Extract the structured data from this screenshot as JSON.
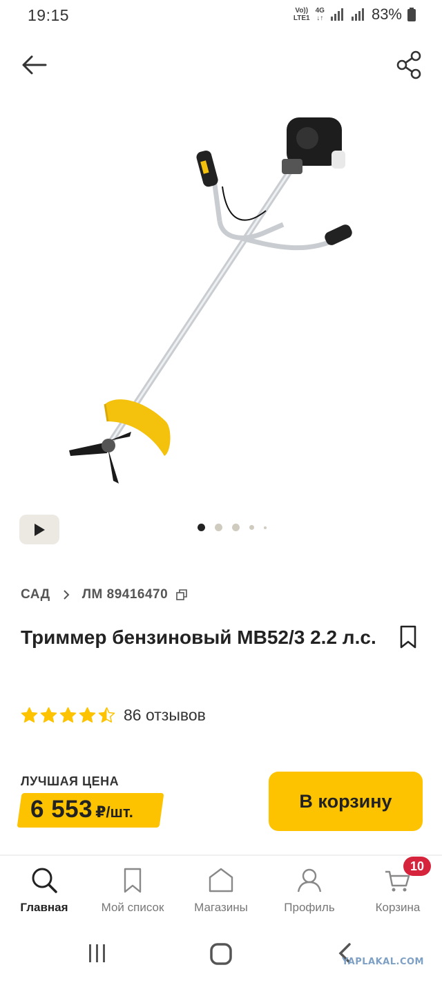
{
  "status_bar": {
    "time": "19:15",
    "volte_top": "Vo))",
    "volte_bottom": "LTE1",
    "network_top": "4G",
    "network_bottom": "↓↑",
    "battery": "83%"
  },
  "header": {
    "back_icon": "arrow-left-icon",
    "share_icon": "share-icon"
  },
  "gallery": {
    "image_alt": "trimmer-product-image",
    "video_icon": "play-icon",
    "dot_count": 5,
    "active_dot": 0
  },
  "breadcrumb": {
    "category": "САД",
    "article": "ЛМ 89416470"
  },
  "product": {
    "title": "Триммер бензиновый MB52/3 2.2 л.с.",
    "rating": 4.5,
    "rating_max": 5,
    "reviews": "86 отзывов"
  },
  "pricing": {
    "label": "ЛУЧШАЯ ЦЕНА",
    "value": "6 553",
    "unit": "₽/шт.",
    "add_to_cart": "В корзину"
  },
  "bottom_nav": {
    "items": [
      {
        "label": "Главная",
        "icon": "search-icon",
        "active": true
      },
      {
        "label": "Мой список",
        "icon": "bookmark-icon"
      },
      {
        "label": "Магазины",
        "icon": "store-icon"
      },
      {
        "label": "Профиль",
        "icon": "user-icon"
      },
      {
        "label": "Корзина",
        "icon": "cart-icon",
        "badge": "10"
      }
    ]
  },
  "watermark": "YAPLAKAL.COM",
  "colors": {
    "accent": "#fdc300",
    "badge": "#d6243c",
    "text": "#222222",
    "muted": "#777777"
  }
}
